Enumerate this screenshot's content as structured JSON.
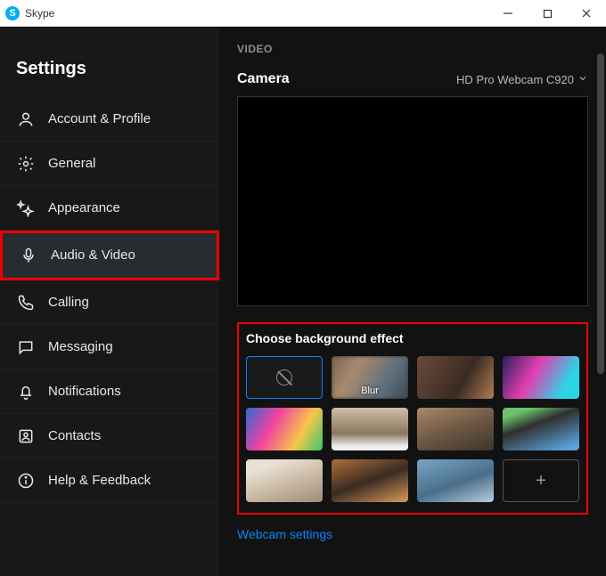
{
  "window": {
    "title": "Skype",
    "logoLetter": "S"
  },
  "sidebar": {
    "heading": "Settings",
    "items": [
      {
        "id": "account",
        "label": "Account & Profile"
      },
      {
        "id": "general",
        "label": "General"
      },
      {
        "id": "appearance",
        "label": "Appearance"
      },
      {
        "id": "audiovideo",
        "label": "Audio & Video",
        "active": true,
        "highlighted": true
      },
      {
        "id": "calling",
        "label": "Calling"
      },
      {
        "id": "messaging",
        "label": "Messaging"
      },
      {
        "id": "notifications",
        "label": "Notifications"
      },
      {
        "id": "contacts",
        "label": "Contacts"
      },
      {
        "id": "help",
        "label": "Help & Feedback"
      }
    ]
  },
  "content": {
    "sectionLabel": "VIDEO",
    "cameraLabel": "Camera",
    "cameraValue": "HD Pro Webcam C920",
    "bgTitle": "Choose background effect",
    "tiles": {
      "blurLabel": "Blur"
    },
    "link": "Webcam settings"
  }
}
